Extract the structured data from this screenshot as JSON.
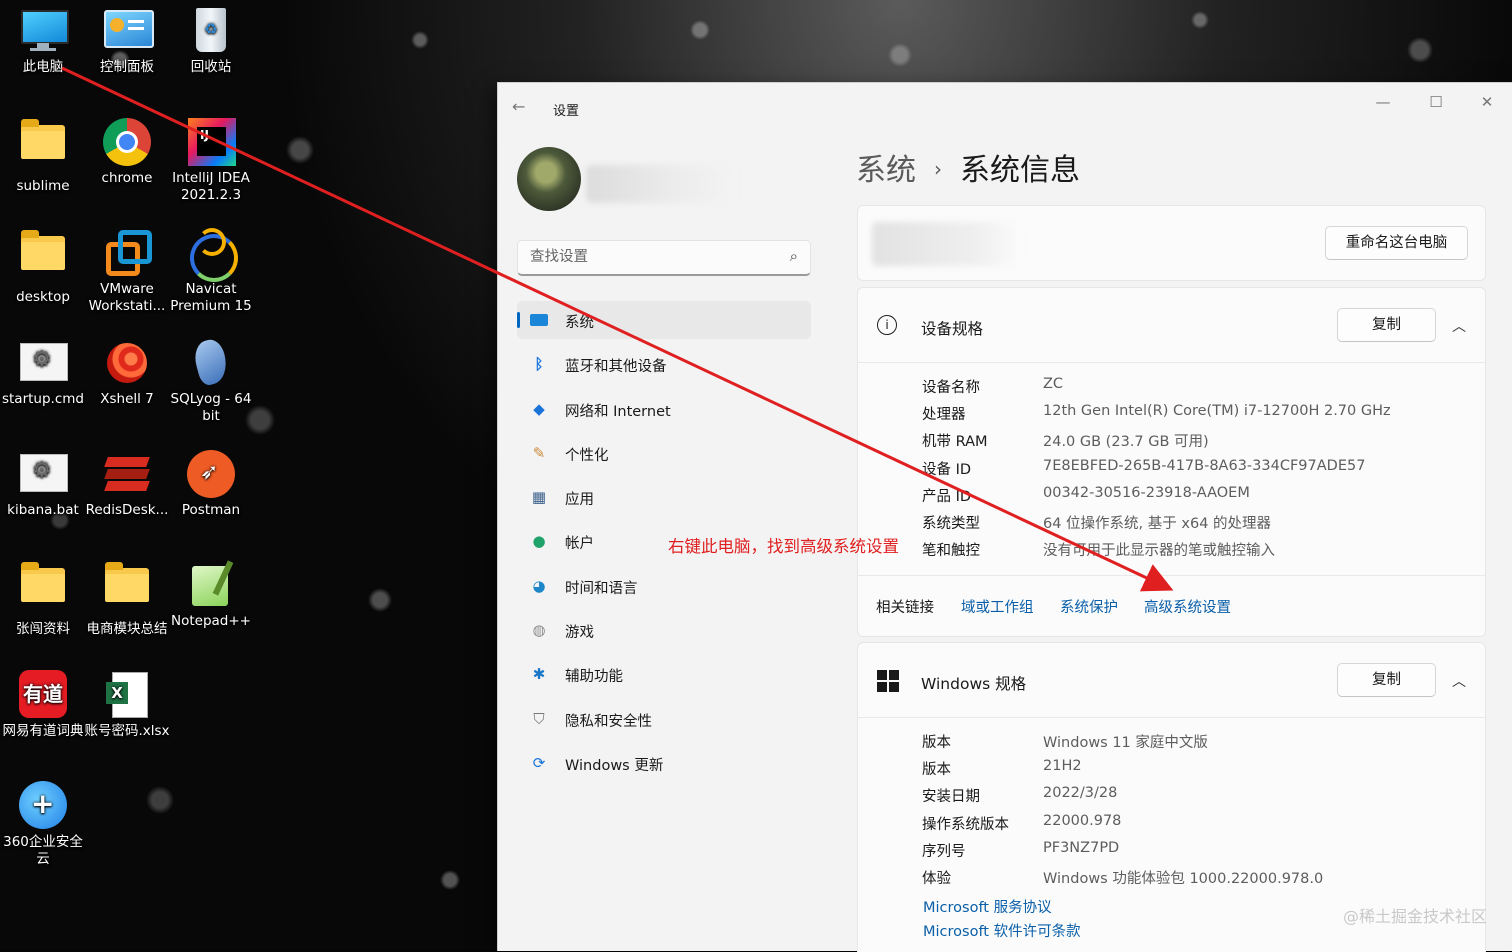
{
  "desktop": {
    "icons": [
      {
        "label": "此电脑",
        "icon": "computer-icon"
      },
      {
        "label": "控制面板",
        "icon": "control-panel-icon"
      },
      {
        "label": "回收站",
        "icon": "recycle-bin-icon"
      },
      {
        "label": "sublime",
        "icon": "folder-icon"
      },
      {
        "label": "chrome",
        "icon": "chrome-icon"
      },
      {
        "label": "IntelliJ IDEA 2021.2.3",
        "icon": "intellij-icon"
      },
      {
        "label": "desktop",
        "icon": "folder-icon"
      },
      {
        "label": "VMware Workstati...",
        "icon": "vmware-icon"
      },
      {
        "label": "Navicat Premium 15",
        "icon": "navicat-icon"
      },
      {
        "label": "startup.cmd",
        "icon": "batch-file-icon"
      },
      {
        "label": "Xshell 7",
        "icon": "xshell-icon"
      },
      {
        "label": "SQLyog - 64 bit",
        "icon": "sqlyog-icon"
      },
      {
        "label": "kibana.bat",
        "icon": "batch-file-icon"
      },
      {
        "label": "RedisDesk...",
        "icon": "redis-icon"
      },
      {
        "label": "Postman",
        "icon": "postman-icon"
      },
      {
        "label": "张闯资料",
        "icon": "folder-icon"
      },
      {
        "label": "电商模块总结",
        "icon": "folder-icon"
      },
      {
        "label": "Notepad++",
        "icon": "notepadpp-icon"
      },
      {
        "label": "网易有道词典",
        "icon": "youdao-icon"
      },
      {
        "label": "账号密码.xlsx",
        "icon": "excel-icon"
      },
      {
        "label": "360企业安全云",
        "icon": "360-icon"
      }
    ]
  },
  "window": {
    "title": "设置",
    "back": "←",
    "minimize": "—",
    "maximize": "☐",
    "close": "✕"
  },
  "sidebar": {
    "search_placeholder": "查找设置",
    "items": [
      {
        "label": "系统",
        "icon": "monitor-icon",
        "glyph": "▬",
        "color": "#0a6fc2"
      },
      {
        "label": "蓝牙和其他设备",
        "icon": "bluetooth-icon",
        "glyph": "ᛒ",
        "color": "#1f7ae0"
      },
      {
        "label": "网络和 Internet",
        "icon": "wifi-icon",
        "glyph": "◆",
        "color": "#1a73d8"
      },
      {
        "label": "个性化",
        "icon": "brush-icon",
        "glyph": "✎",
        "color": "#c98a3a"
      },
      {
        "label": "应用",
        "icon": "apps-icon",
        "glyph": "▦",
        "color": "#3a5f8a"
      },
      {
        "label": "帐户",
        "icon": "account-icon",
        "glyph": "●",
        "color": "#1fa36a"
      },
      {
        "label": "时间和语言",
        "icon": "globe-clock-icon",
        "glyph": "◕",
        "color": "#1c86c8"
      },
      {
        "label": "游戏",
        "icon": "gamepad-icon",
        "glyph": "◍",
        "color": "#8a8a8a"
      },
      {
        "label": "辅助功能",
        "icon": "accessibility-icon",
        "glyph": "✱",
        "color": "#1877c9"
      },
      {
        "label": "隐私和安全性",
        "icon": "shield-icon",
        "glyph": "⛉",
        "color": "#7a7a7a"
      },
      {
        "label": "Windows 更新",
        "icon": "update-icon",
        "glyph": "⟳",
        "color": "#1a73d8"
      }
    ]
  },
  "main": {
    "breadcrumb_parent": "系统",
    "breadcrumb_sep": "›",
    "breadcrumb_current": "系统信息",
    "rename_button": "重命名这台电脑",
    "device_specs": {
      "title": "设备规格",
      "copy_button": "复制",
      "rows": [
        {
          "key": "设备名称",
          "value": "ZC"
        },
        {
          "key": "处理器",
          "value": "12th Gen Intel(R) Core(TM) i7-12700H   2.70 GHz"
        },
        {
          "key": "机带 RAM",
          "value": "24.0 GB (23.7 GB 可用)"
        },
        {
          "key": "设备 ID",
          "value": "7E8EBFED-265B-417B-8A63-334CF97ADE57"
        },
        {
          "key": "产品 ID",
          "value": "00342-30516-23918-AAOEM"
        },
        {
          "key": "系统类型",
          "value": "64 位操作系统, 基于 x64 的处理器"
        },
        {
          "key": "笔和触控",
          "value": "没有可用于此显示器的笔或触控输入"
        }
      ]
    },
    "related": {
      "label": "相关链接",
      "links": [
        "域或工作组",
        "系统保护",
        "高级系统设置"
      ]
    },
    "windows_specs": {
      "title": "Windows 规格",
      "copy_button": "复制",
      "rows": [
        {
          "key": "版本",
          "value": "Windows 11 家庭中文版"
        },
        {
          "key": "版本",
          "value": "21H2"
        },
        {
          "key": "安装日期",
          "value": "2022/3/28"
        },
        {
          "key": "操作系统版本",
          "value": "22000.978"
        },
        {
          "key": "序列号",
          "value": "PF3NZ7PD"
        },
        {
          "key": "体验",
          "value": "Windows 功能体验包 1000.22000.978.0"
        }
      ],
      "links": [
        "Microsoft 服务协议",
        "Microsoft 软件许可条款"
      ]
    }
  },
  "annotation": {
    "text": "右键此电脑，找到高级系统设置",
    "color": "#e02020"
  },
  "watermark": "@稀土掘金技术社区"
}
